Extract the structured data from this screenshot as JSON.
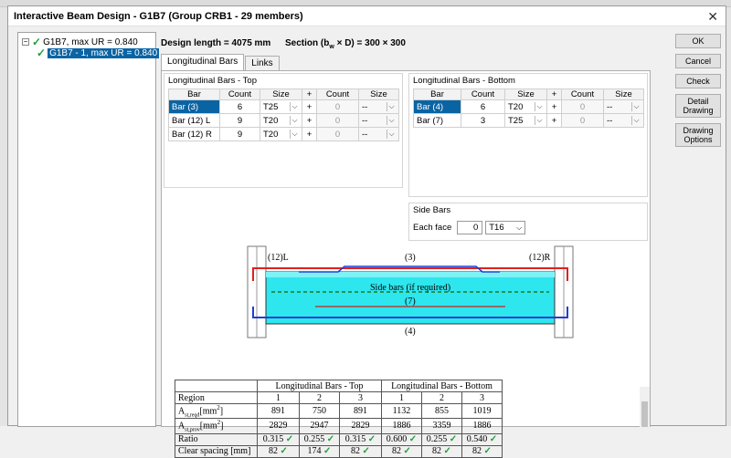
{
  "window": {
    "title": "Interactive Beam Design - G1B7 (Group CRB1 - 29 members)"
  },
  "tree": {
    "root": "G1B7, max UR = 0.840",
    "child": "G1B7 - 1, max UR = 0.840"
  },
  "header": {
    "design_length": "Design length = 4075 mm",
    "section": "Section (b",
    "section_sub": "w",
    "section_rest": " × D) = 300 × 300"
  },
  "tabs": [
    "Longitudinal Bars",
    "Links"
  ],
  "top_bars": {
    "title": "Longitudinal Bars - Top",
    "headers": [
      "Bar",
      "Count",
      "Size",
      "+",
      "Count",
      "Size"
    ],
    "rows": [
      {
        "bar": "Bar (3)",
        "count": "6",
        "size": "T25",
        "plus": "+",
        "count2": "0",
        "size2": "--"
      },
      {
        "bar": "Bar (12) L",
        "count": "9",
        "size": "T20",
        "plus": "+",
        "count2": "0",
        "size2": "--"
      },
      {
        "bar": "Bar (12) R",
        "count": "9",
        "size": "T20",
        "plus": "+",
        "count2": "0",
        "size2": "--"
      }
    ]
  },
  "bottom_bars": {
    "title": "Longitudinal Bars - Bottom",
    "headers": [
      "Bar",
      "Count",
      "Size",
      "+",
      "Count",
      "Size"
    ],
    "rows": [
      {
        "bar": "Bar (4)",
        "count": "6",
        "size": "T20",
        "plus": "+",
        "count2": "0",
        "size2": "--"
      },
      {
        "bar": "Bar (7)",
        "count": "3",
        "size": "T25",
        "plus": "+",
        "count2": "0",
        "size2": "--"
      }
    ]
  },
  "side_bars": {
    "title": "Side Bars",
    "label": "Each face",
    "count": "0",
    "size": "T16"
  },
  "diagram": {
    "label_12l": "(12)L",
    "label_3": "(3)",
    "label_12r": "(12)R",
    "label_side": "Side bars (if required)",
    "label_7": "(7)",
    "label_4": "(4)"
  },
  "results": {
    "group_top": "Longitudinal Bars - Top",
    "group_bottom": "Longitudinal Bars - Bottom",
    "region_label": "Region",
    "regions": [
      "1",
      "2",
      "3",
      "1",
      "2",
      "3"
    ],
    "ast_reqd_label": "A",
    "ast_reqd_sub": "st,reqd",
    "ast_prov_sub": "st,prov",
    "unit": "[mm",
    "unit_sup": "2",
    "unit_close": "]",
    "ast_reqd": [
      "891",
      "750",
      "891",
      "1132",
      "855",
      "1019"
    ],
    "ast_prov": [
      "2829",
      "2947",
      "2829",
      "1886",
      "3359",
      "1886"
    ],
    "ratio_label": "Ratio",
    "ratio": [
      "0.315",
      "0.255",
      "0.315",
      "0.600",
      "0.255",
      "0.540"
    ],
    "spacing_label": "Clear spacing [mm]",
    "spacing": [
      "82",
      "174",
      "82",
      "82",
      "82",
      "82"
    ],
    "check": "✓"
  },
  "buttons": {
    "ok": "OK",
    "cancel": "Cancel",
    "check": "Check",
    "detail_drawing": "Detail Drawing",
    "drawing_options": "Drawing Options"
  }
}
